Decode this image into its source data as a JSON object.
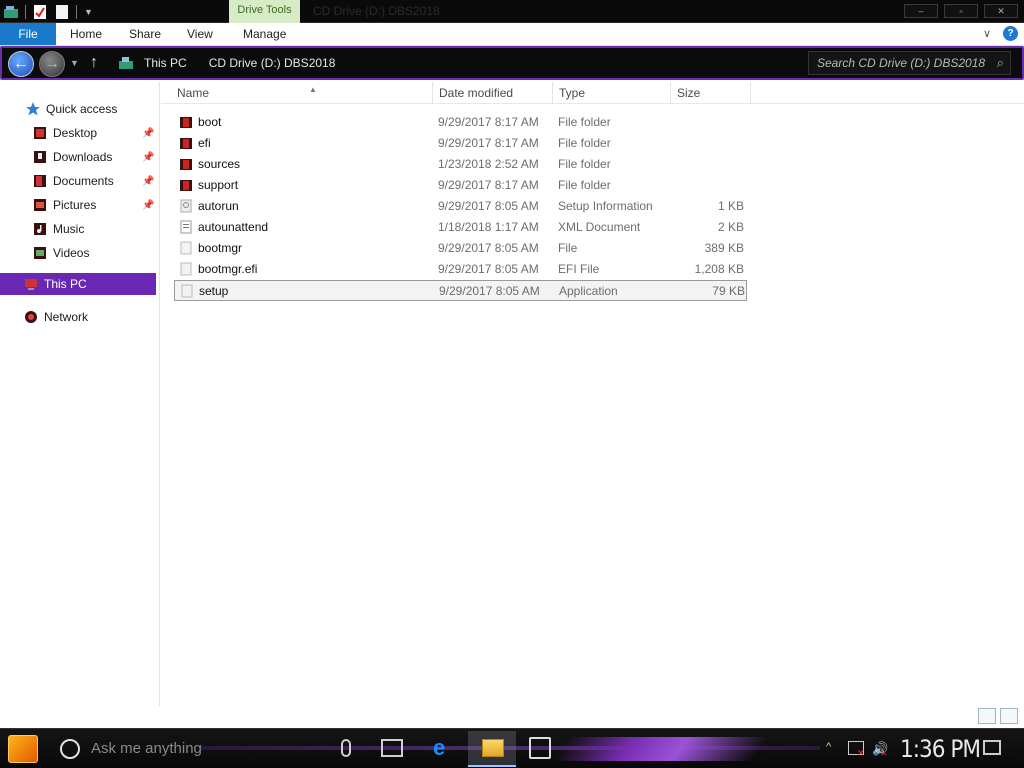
{
  "window": {
    "title": "CD Drive (D:) DBS2018",
    "context_tab": "Drive Tools",
    "buttons": [
      "–",
      "▫",
      "✕"
    ]
  },
  "ribbon": {
    "tabs": [
      {
        "label": "File"
      },
      {
        "label": "Home"
      },
      {
        "label": "Share"
      },
      {
        "label": "View"
      },
      {
        "label": "Manage"
      }
    ],
    "help": "?"
  },
  "address": {
    "crumbs": [
      "This PC",
      "CD Drive (D:) DBS2018"
    ],
    "search_placeholder": "Search CD Drive (D:) DBS2018"
  },
  "nav": {
    "quick_access": "Quick access",
    "items": [
      {
        "label": "Desktop",
        "pinned": true
      },
      {
        "label": "Downloads",
        "pinned": true
      },
      {
        "label": "Documents",
        "pinned": true
      },
      {
        "label": "Pictures",
        "pinned": true
      },
      {
        "label": "Music",
        "pinned": false
      },
      {
        "label": "Videos",
        "pinned": false
      }
    ],
    "this_pc": "This PC",
    "network": "Network"
  },
  "columns": {
    "name": "Name",
    "date": "Date modified",
    "type": "Type",
    "size": "Size"
  },
  "files": [
    {
      "name": "boot",
      "date": "9/29/2017 8:17 AM",
      "type": "File folder",
      "size": "",
      "kind": "folder"
    },
    {
      "name": "efi",
      "date": "9/29/2017 8:17 AM",
      "type": "File folder",
      "size": "",
      "kind": "folder"
    },
    {
      "name": "sources",
      "date": "1/23/2018 2:52 AM",
      "type": "File folder",
      "size": "",
      "kind": "folder"
    },
    {
      "name": "support",
      "date": "9/29/2017 8:17 AM",
      "type": "File folder",
      "size": "",
      "kind": "folder"
    },
    {
      "name": "autorun",
      "date": "9/29/2017 8:05 AM",
      "type": "Setup Information",
      "size": "1 KB",
      "kind": "inf"
    },
    {
      "name": "autounattend",
      "date": "1/18/2018 1:17 AM",
      "type": "XML Document",
      "size": "2 KB",
      "kind": "xml"
    },
    {
      "name": "bootmgr",
      "date": "9/29/2017 8:05 AM",
      "type": "File",
      "size": "389 KB",
      "kind": "file"
    },
    {
      "name": "bootmgr.efi",
      "date": "9/29/2017 8:05 AM",
      "type": "EFI File",
      "size": "1,208 KB",
      "kind": "file"
    },
    {
      "name": "setup",
      "date": "9/29/2017 8:05 AM",
      "type": "Application",
      "size": "79 KB",
      "kind": "app",
      "selected": true
    }
  ],
  "taskbar": {
    "search_placeholder": "Ask me anything",
    "clock": "1:36 PM"
  },
  "colors": {
    "accent": "#1979ca",
    "selection_purple": "#6a27b4",
    "drive_tools_bg": "#d7ebc6"
  }
}
